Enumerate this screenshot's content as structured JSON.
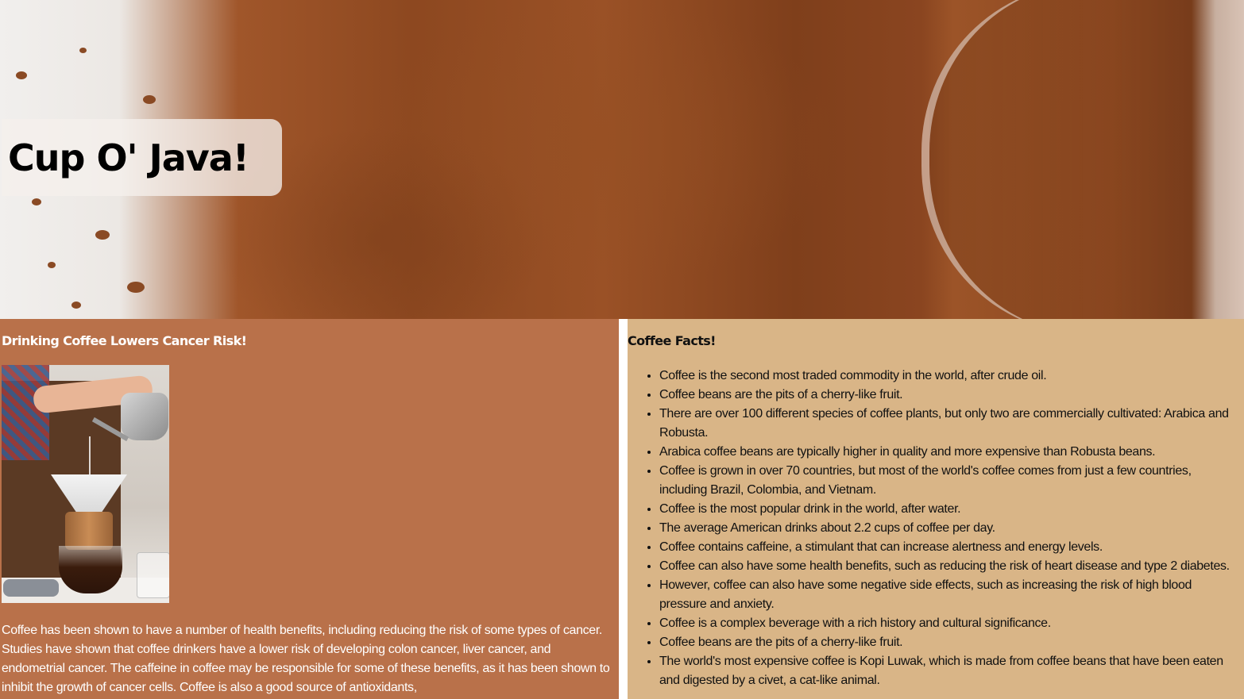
{
  "hero": {
    "title": "Cup O' Java!",
    "image_description": "ground coffee"
  },
  "left_panel": {
    "heading": "Drinking Coffee Lowers Cancer Risk!",
    "photo_alt": "pour-over coffee",
    "paragraph": "Coffee has been shown to have a number of health benefits, including reducing the risk of some types of cancer. Studies have shown that coffee drinkers have a lower risk of developing colon cancer, liver cancer, and endometrial cancer. The caffeine in coffee may be responsible for some of these benefits, as it has been shown to inhibit the growth of cancer cells. Coffee is also a good source of antioxidants,"
  },
  "right_panel": {
    "heading": "Coffee Facts!",
    "facts": [
      "Coffee is the second most traded commodity in the world, after crude oil.",
      "Coffee beans are the pits of a cherry-like fruit.",
      "There are over 100 different species of coffee plants, but only two are commercially cultivated: Arabica and Robusta.",
      "Arabica coffee beans are typically higher in quality and more expensive than Robusta beans.",
      "Coffee is grown in over 70 countries, but most of the world's coffee comes from just a few countries, including Brazil, Colombia, and Vietnam.",
      "Coffee is the most popular drink in the world, after water.",
      "The average American drinks about 2.2 cups of coffee per day.",
      "Coffee contains caffeine, a stimulant that can increase alertness and energy levels.",
      "Coffee can also have some health benefits, such as reducing the risk of heart disease and type 2 diabetes.",
      "However, coffee can also have some negative side effects, such as increasing the risk of high blood pressure and anxiety.",
      "Coffee is a complex beverage with a rich history and cultural significance.",
      "Coffee beans are the pits of a cherry-like fruit.",
      "The world's most expensive coffee is Kopi Luwak, which is made from coffee beans that have been eaten and digested by a civet, a cat-like animal."
    ]
  },
  "colors": {
    "left_panel_bg": "#b9714a",
    "right_panel_bg": "#d9b587",
    "left_text": "#ffffff",
    "right_text": "#111111"
  }
}
